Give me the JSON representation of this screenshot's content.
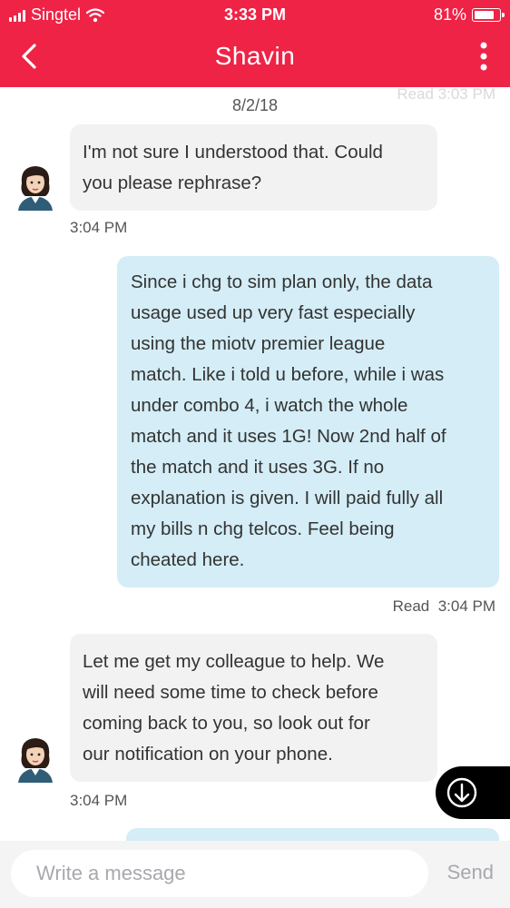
{
  "status_bar": {
    "carrier": "Singtel",
    "time": "3:33 PM",
    "battery": "81%",
    "battery_level": 0.81
  },
  "header": {
    "title": "Shavin",
    "back_icon": "chevron-left-icon",
    "more_icon": "more-vertical-icon",
    "background_color": "#ee2346"
  },
  "chat": {
    "faded_status": "Read  3:03 PM",
    "date": "8/2/18",
    "messages": [
      {
        "direction": "incoming",
        "lines": [
          "I'm not sure I understood that. Could",
          "you please rephrase?"
        ],
        "time": "3:04 PM"
      },
      {
        "direction": "outgoing",
        "lines": [
          "Since i chg to sim plan only, the data",
          "usage used up very fast especially",
          "using the miotv premier league",
          "match. Like i told u before, while i was",
          "under combo 4, i watch the whole",
          "match and it uses 1G! Now 2nd half of",
          "the match and it uses 3G. If no",
          "explanation is given. I will paid fully all",
          "my bills n chg telcos. Feel being",
          "cheated here."
        ],
        "status": "Read",
        "time": "3:04 PM"
      },
      {
        "direction": "incoming",
        "lines": [
          "Let me get my colleague to help. We",
          "will need some time to check before",
          "coming back to you, so look out for",
          "our notification on your phone."
        ],
        "time": "3:04 PM"
      }
    ],
    "incoming_bubble_color": "#f2f2f3",
    "outgoing_bubble_color": "#d4edf6"
  },
  "composer": {
    "placeholder": "Write a message",
    "value": "",
    "send_label": "Send"
  }
}
